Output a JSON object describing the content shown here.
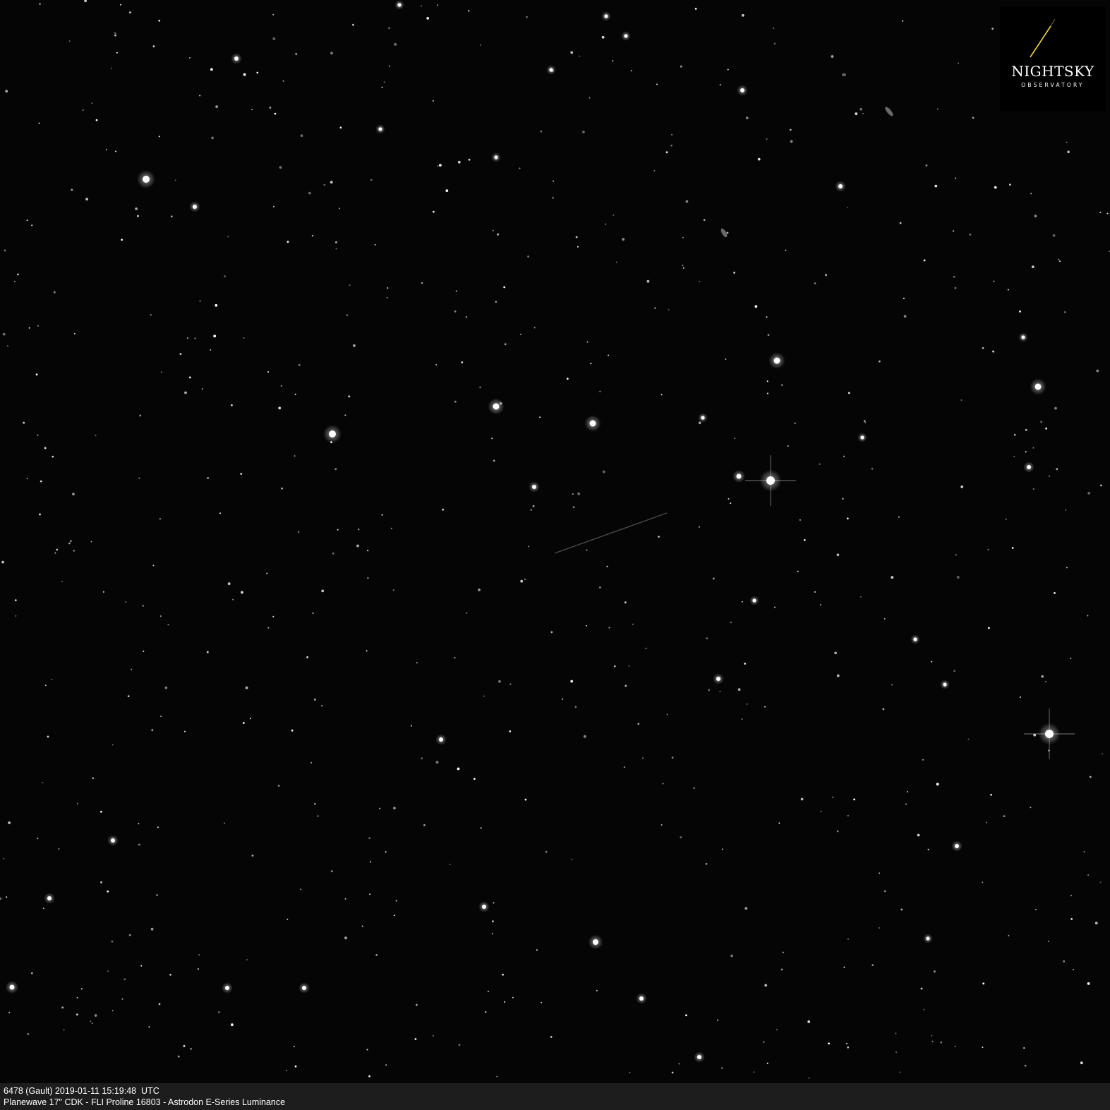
{
  "logo": {
    "title": "NIGHTSKY",
    "subtitle": "OBSERVATORY",
    "streak_color": "#f2d24a"
  },
  "caption": {
    "line1": "6478 (Gault) 2019-01-11 15:19:48  UTC",
    "line2": "Planewave 17\" CDK - FLI Proline 16803 - Astrodon E-Series Luminance"
  },
  "colors": {
    "sky": "#050505",
    "star": "#ffffff",
    "caption_bar": "#1d1d1d"
  }
}
